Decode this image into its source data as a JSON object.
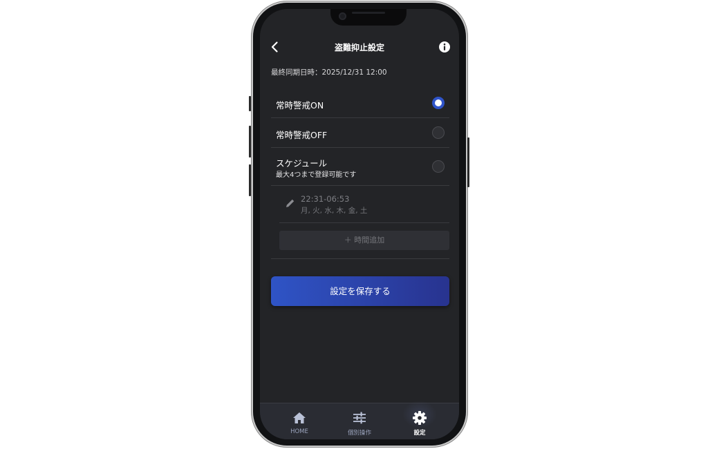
{
  "header": {
    "title": "盗難抑止設定"
  },
  "last_sync": {
    "label": "最終同期日時：",
    "value": "2025/12/31 12:00"
  },
  "options": [
    {
      "label": "常時警戒ON",
      "selected": true
    },
    {
      "label": "常時警戒OFF",
      "selected": false
    },
    {
      "label": "スケジュール",
      "sub": "最大4つまで登録可能です",
      "selected": false
    }
  ],
  "schedule": {
    "time": "22:31-06:53",
    "days": "月, 火, 水, 木, 金, 土"
  },
  "add_time_label": "＋ 時間追加",
  "save_label": "設定を保存する",
  "tabs": [
    {
      "label": "HOME",
      "icon": "home-icon",
      "active": false
    },
    {
      "label": "個別操作",
      "icon": "sliders-icon",
      "active": false
    },
    {
      "label": "設定",
      "icon": "gear-icon",
      "active": true
    }
  ],
  "colors": {
    "background": "#232427",
    "accent": "#2f54c9",
    "tabbar": "#2a2c33"
  }
}
